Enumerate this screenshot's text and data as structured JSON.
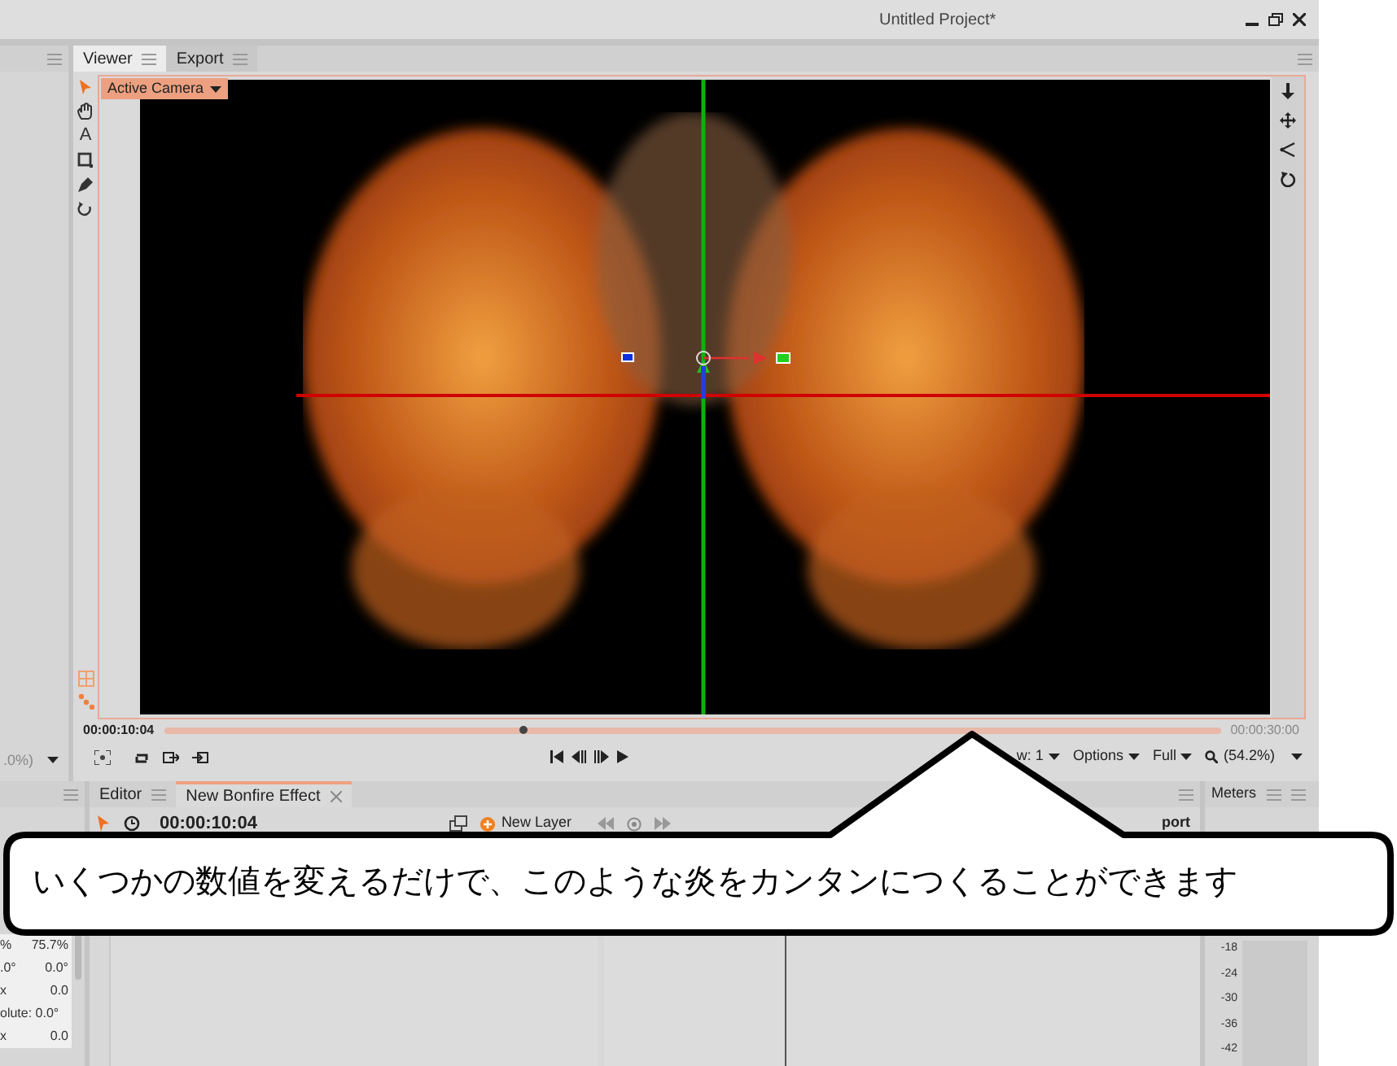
{
  "window": {
    "title": "Untitled Project*"
  },
  "viewer_tabs": [
    {
      "label": "Viewer",
      "selected": true
    },
    {
      "label": "Export",
      "selected": false
    }
  ],
  "camera_dropdown": {
    "label": "Active Camera"
  },
  "left_tools": [
    {
      "kind": "pointer",
      "selected": true
    },
    {
      "kind": "hand",
      "selected": false
    },
    {
      "kind": "text",
      "label": "A",
      "selected": false
    },
    {
      "kind": "rectangle",
      "selected": false
    },
    {
      "kind": "pen",
      "selected": false
    },
    {
      "kind": "orbit",
      "selected": false
    }
  ],
  "right_tools": [
    {
      "kind": "down"
    },
    {
      "kind": "move"
    },
    {
      "kind": "angle"
    },
    {
      "kind": "rotate"
    }
  ],
  "timeline": {
    "current_time": "00:00:10:04",
    "end_time": "00:00:30:00",
    "level": 0.34
  },
  "viewer_controls": {
    "zoom_left": ".0%)",
    "dropdowns": [
      {
        "label": "w: 1",
        "kind": "plain"
      },
      {
        "label": "Options",
        "kind": "plain"
      },
      {
        "label": "Full",
        "kind": "plain"
      },
      {
        "label": "(54.2%)",
        "kind": "zoom"
      }
    ]
  },
  "editor_tabs": [
    {
      "label": "Editor",
      "selected": false,
      "closable": false
    },
    {
      "label": "New Bonfire Effect",
      "selected": true,
      "closable": true
    }
  ],
  "editor_toolbar": {
    "time": "00:00:10:04",
    "new_layer": "New Layer",
    "cut_label": "port"
  },
  "properties": [
    {
      "label": "%",
      "value": "75.7%"
    },
    {
      "label": ".0°",
      "value": "0.0°"
    },
    {
      "label": "x",
      "value": "0.0"
    },
    {
      "label": "olute: 0.0°"
    },
    {
      "label": "x",
      "value": "0.0"
    }
  ],
  "meters": {
    "title": "Meters",
    "scale": [
      "-18",
      "-24",
      "-30",
      "-36",
      "-42"
    ]
  },
  "callout": {
    "text": "いくつかの数値を変えるだけで、このような炎をカンタンにつくることができます"
  }
}
